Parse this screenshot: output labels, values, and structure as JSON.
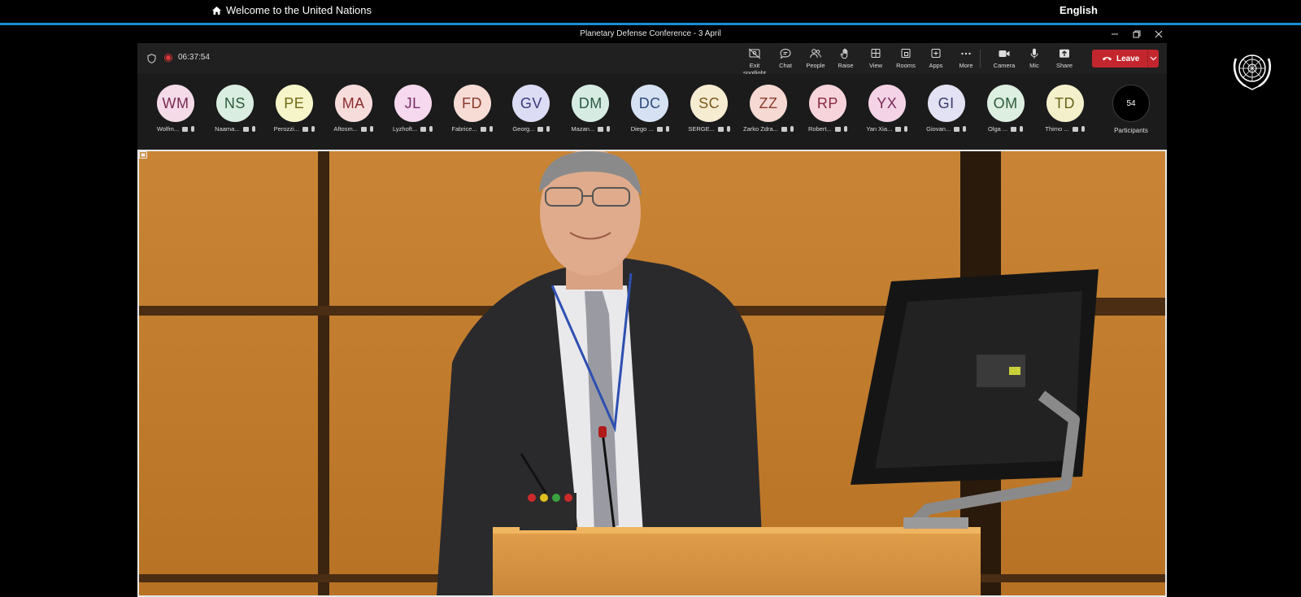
{
  "site": {
    "home_label": "Welcome to the United Nations",
    "language": "English"
  },
  "window": {
    "title": "Planetary Defense Conference - 3 April"
  },
  "toolbar": {
    "timer": "06:37:54",
    "buttons": [
      {
        "label": "Exit spotlight",
        "icon": "exit-spotlight-icon"
      },
      {
        "label": "Chat",
        "icon": "chat-icon"
      },
      {
        "label": "People",
        "icon": "people-icon"
      },
      {
        "label": "Raise",
        "icon": "raise-hand-icon"
      },
      {
        "label": "View",
        "icon": "view-icon"
      },
      {
        "label": "Rooms",
        "icon": "rooms-icon"
      },
      {
        "label": "Apps",
        "icon": "apps-icon"
      },
      {
        "label": "More",
        "icon": "more-icon"
      },
      {
        "label": "Camera",
        "icon": "camera-icon"
      },
      {
        "label": "Mic",
        "icon": "mic-icon"
      },
      {
        "label": "Share",
        "icon": "share-icon"
      }
    ],
    "leave_label": "Leave"
  },
  "participants": {
    "count": "54",
    "count_label": "Participants",
    "list": [
      {
        "initials": "WM",
        "name": "Wolfm...",
        "bg": "#f5dbe8",
        "fg": "#7a2a4f"
      },
      {
        "initials": "NS",
        "name": "Naama...",
        "bg": "#d9ede0",
        "fg": "#2e5a3b"
      },
      {
        "initials": "PE",
        "name": "Perozzi...",
        "bg": "#f6f5c9",
        "fg": "#6f6a14"
      },
      {
        "initials": "MA",
        "name": "Aftosm...",
        "bg": "#f7dcdc",
        "fg": "#8a2d2d"
      },
      {
        "initials": "JL",
        "name": "Lyzhoft...",
        "bg": "#f6d9ee",
        "fg": "#7a2a66"
      },
      {
        "initials": "FD",
        "name": "Fabrice...",
        "bg": "#f7dcd6",
        "fg": "#8a3a2d"
      },
      {
        "initials": "GV",
        "name": "Georg...",
        "bg": "#dcdcf4",
        "fg": "#3a3a7a"
      },
      {
        "initials": "DM",
        "name": "Mazan...",
        "bg": "#d6ece2",
        "fg": "#2e5a46"
      },
      {
        "initials": "DC",
        "name": "Diego ...",
        "bg": "#d6e2f4",
        "fg": "#2e4a7a"
      },
      {
        "initials": "SC",
        "name": "SERGE...",
        "bg": "#f6ecd2",
        "fg": "#7a5a1e"
      },
      {
        "initials": "ZZ",
        "name": "Zarko Zdra...",
        "bg": "#f7d9d3",
        "fg": "#8a3a2a"
      },
      {
        "initials": "RP",
        "name": "Robert...",
        "bg": "#f7d4dc",
        "fg": "#8a2a3e"
      },
      {
        "initials": "YX",
        "name": "Yan Xia...",
        "bg": "#f5d3e6",
        "fg": "#7a2a58"
      },
      {
        "initials": "GI",
        "name": "Giovan...",
        "bg": "#e2e2f4",
        "fg": "#3a3a6a"
      },
      {
        "initials": "OM",
        "name": "Olga ...",
        "bg": "#dcefe0",
        "fg": "#2e5a3a"
      },
      {
        "initials": "TD",
        "name": "Thimo ...",
        "bg": "#f4f0cc",
        "fg": "#6a6418"
      }
    ]
  },
  "colors": {
    "accent_blue": "#1b8fd6",
    "leave_red": "#c4262e",
    "recording": "#e0353b"
  }
}
